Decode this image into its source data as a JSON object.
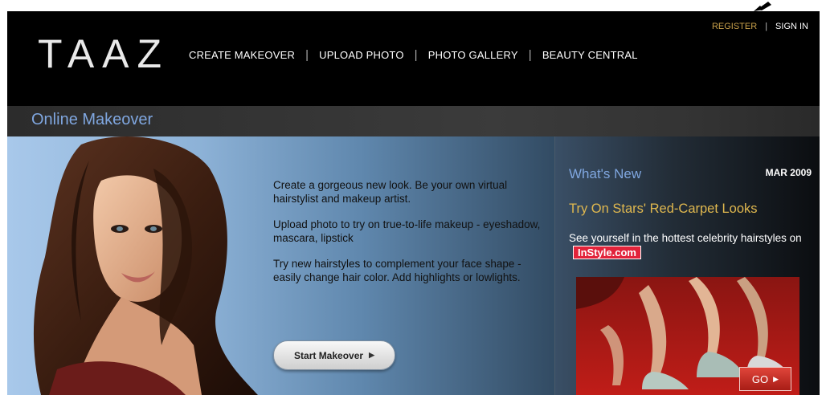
{
  "header": {
    "logo": "TAAZ",
    "nav": [
      {
        "label": "CREATE MAKEOVER"
      },
      {
        "label": "UPLOAD PHOTO"
      },
      {
        "label": "PHOTO GALLERY"
      },
      {
        "label": "BEAUTY CENTRAL"
      }
    ],
    "register": "REGISTER",
    "separator": "|",
    "sign_in": "SIGN IN"
  },
  "page_title": "Online Makeover",
  "hero": {
    "paragraphs": [
      "Create a gorgeous new look. Be your own virtual hairstylist and makeup artist.",
      "Upload photo to try on true-to-life makeup - eyeshadow, mascara, lipstick",
      "Try new hairstyles to complement your face shape - easily change hair color. Add highlights or lowlights."
    ],
    "start_label": "Start Makeover",
    "start_arrow": "▶"
  },
  "news": {
    "heading": "What's New",
    "date": "MAR 2009",
    "headline": "Try On Stars' Red-Carpet Looks",
    "blurb": "See yourself in the hottest celebrity hairstyles on",
    "instyle": "InStyle.com",
    "go_label": "GO",
    "go_arrow": "▶"
  },
  "colors": {
    "accent_blue": "#7fa6df",
    "accent_gold": "#e0b84f",
    "brand_red": "#e2233a"
  }
}
